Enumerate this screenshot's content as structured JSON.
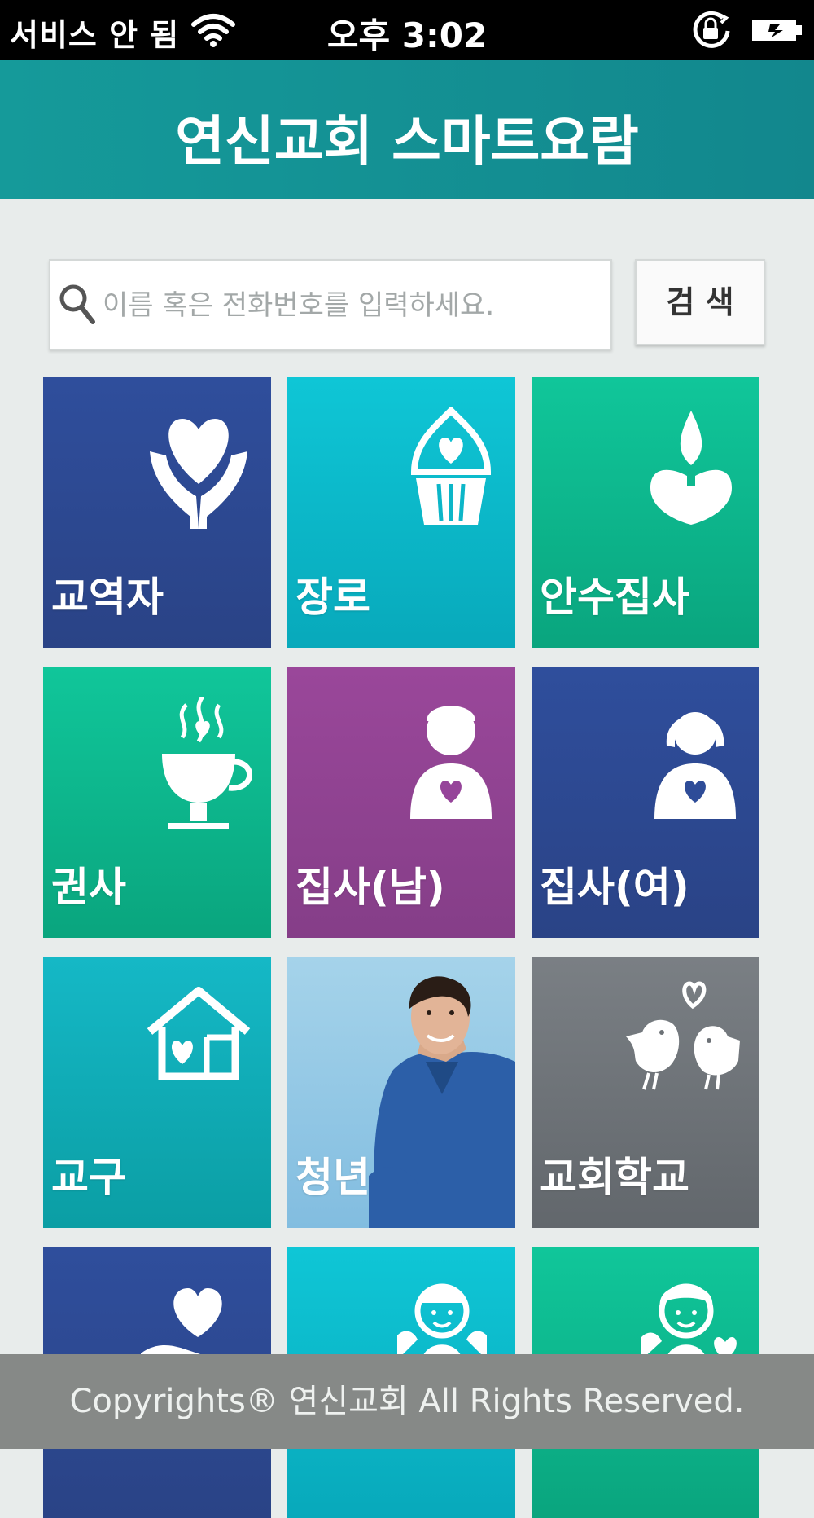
{
  "status_bar": {
    "carrier": "서비스 안 됨",
    "time": "오후 3:02"
  },
  "app": {
    "title": "연신교회 스마트요람"
  },
  "search": {
    "placeholder": "이름 혹은 전화번호를 입력하세요.",
    "button_label": "검 색"
  },
  "tiles": [
    {
      "label": "교역자",
      "icon": "heart-hands-icon",
      "color": "#2f4e9c"
    },
    {
      "label": "장로",
      "icon": "cupcake-heart-icon",
      "color": "#0fc6d6"
    },
    {
      "label": "안수집사",
      "icon": "candle-icon",
      "color": "#10c69a"
    },
    {
      "label": "권사",
      "icon": "coffee-cup-hearts-icon",
      "color": "#10c69a"
    },
    {
      "label": "집사(남)",
      "icon": "man-heart-icon",
      "color": "#9a479a"
    },
    {
      "label": "집사(여)",
      "icon": "woman-heart-icon",
      "color": "#2f4e9c"
    },
    {
      "label": "교구",
      "icon": "house-heart-icon",
      "color": "#15b8c6"
    },
    {
      "label": "청년",
      "icon": "young-man-photo",
      "color": "#a5d3ea"
    },
    {
      "label": "교회학교",
      "icon": "love-birds-icon",
      "color": "#7a7f84"
    },
    {
      "label": "",
      "icon": "hand-heart-icon",
      "color": "#2f4e9c"
    },
    {
      "label": "",
      "icon": "cherub-icon",
      "color": "#0fc6d6"
    },
    {
      "label": "",
      "icon": "cherub-heart-icon",
      "color": "#10c69a"
    }
  ],
  "footer": {
    "text": "Copyrights® 연신교회 All Rights Reserved."
  }
}
